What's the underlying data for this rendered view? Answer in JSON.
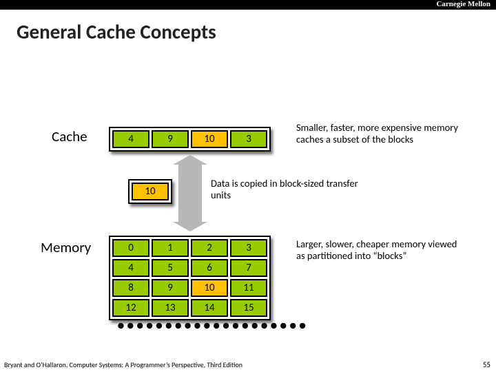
{
  "brand": "Carnegie Mellon",
  "title": "General Cache Concepts",
  "labels": {
    "cache": "Cache",
    "memory": "Memory"
  },
  "cache_row": [
    "4",
    "9",
    "10",
    "3"
  ],
  "cache_highlight_index": 2,
  "transfer_block": "10",
  "memory_grid": [
    [
      "0",
      "1",
      "2",
      "3"
    ],
    [
      "4",
      "5",
      "6",
      "7"
    ],
    [
      "8",
      "9",
      "10",
      "11"
    ],
    [
      "12",
      "13",
      "14",
      "15"
    ]
  ],
  "memory_highlight": {
    "row": 2,
    "col": 2
  },
  "notes": {
    "cache_note": "Smaller, faster, more expensive memory caches a  subset of the blocks",
    "transfer_note": "Data is copied in block-sized transfer units",
    "memory_note": "Larger, slower, cheaper memory viewed as partitioned into “blocks”"
  },
  "footer": "Bryant and O’Hallaron, Computer Systems: A Programmer’s Perspective, Third Edition",
  "page_number": "55"
}
